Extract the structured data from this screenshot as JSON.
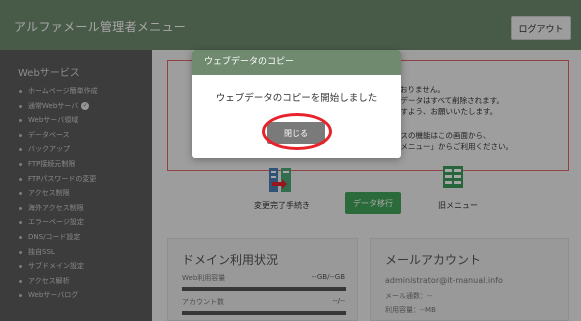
{
  "header": {
    "app_title": "アルファメール管理者メニュー",
    "logout_label": "ログアウト"
  },
  "sidebar": {
    "section_title": "Webサービス",
    "items": [
      {
        "label": "ホームページ簡単作成"
      },
      {
        "label": "通常Webサーバ",
        "checked": true
      },
      {
        "label": "Webサーバ領域"
      },
      {
        "label": "データベース"
      },
      {
        "label": "バックアップ"
      },
      {
        "label": "FTP接続元制限"
      },
      {
        "label": "FTPパスワードの変更"
      },
      {
        "label": "アクセス制限"
      },
      {
        "label": "海外アクセス制限"
      },
      {
        "label": "エラーページ設定"
      },
      {
        "label": "DNS/コード設定"
      },
      {
        "label": "独自SSL"
      },
      {
        "label": "サブドメイン設定"
      },
      {
        "label": "アクセス解析"
      },
      {
        "label": "Webサーバログ"
      }
    ]
  },
  "notice": {
    "title": "す。",
    "lines": [
      "了しておりません。",
      "環境とデータはすべて削除されます。",
      "できますよう、お願いいたします。",
      "サービスの機能はこの画面から、",
      "の「旧メニュー」からご利用ください。"
    ]
  },
  "actions": {
    "change_complete_label": "変更完了手続き",
    "migrate_label": "データ移行",
    "old_menu_label": "旧メニュー"
  },
  "domain_card": {
    "title": "ドメイン利用状況",
    "web_usage_label": "Web利用容量",
    "web_usage_value": "--GB/--GB",
    "account_count_label": "アカウント数",
    "account_count_value": "--/--"
  },
  "mail_card": {
    "title": "メールアカウント",
    "address": "administrator@it-manual.info",
    "mail_count": "メール通数：--",
    "usage": "利用容量：--MB"
  },
  "modal": {
    "title": "ウェブデータのコピー",
    "message": "ウェブデータのコピーを開始しました",
    "close_label": "閉じる"
  },
  "colors": {
    "header": "#6f8a6f",
    "sidebar": "#5c5c5c",
    "accent_red": "#e8212a",
    "button_green": "#42a35a"
  }
}
